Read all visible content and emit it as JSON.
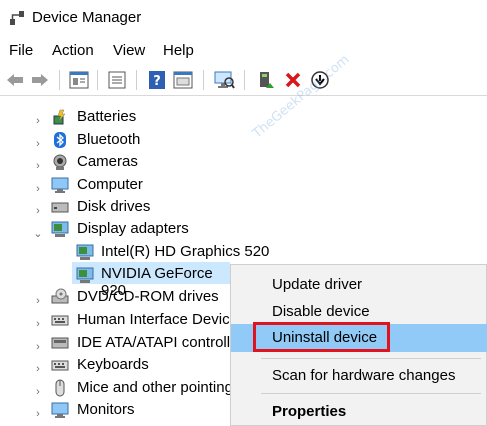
{
  "window": {
    "title": "Device Manager"
  },
  "menu": [
    "File",
    "Action",
    "View",
    "Help"
  ],
  "toolbar": {
    "buttons": [
      "back-icon",
      "forward-icon",
      "properties-icon",
      "list-icon",
      "help-icon",
      "run-icon",
      "scan-hardware-icon",
      "update-driver-icon",
      "uninstall-icon",
      "download-icon"
    ]
  },
  "tree": {
    "items": [
      {
        "label": "Batteries",
        "expanded": false
      },
      {
        "label": "Bluetooth",
        "expanded": false
      },
      {
        "label": "Cameras",
        "expanded": false
      },
      {
        "label": "Computer",
        "expanded": false
      },
      {
        "label": "Disk drives",
        "expanded": false
      },
      {
        "label": "Display adapters",
        "expanded": true
      },
      {
        "label": "Intel(R) HD Graphics 520",
        "child": true
      },
      {
        "label": "NVIDIA GeForce 920",
        "child": true,
        "selected": true
      },
      {
        "label": "DVD/CD-ROM drives",
        "expanded": false
      },
      {
        "label": "Human Interface Device",
        "expanded": false
      },
      {
        "label": "IDE ATA/ATAPI controller",
        "expanded": false
      },
      {
        "label": "Keyboards",
        "expanded": false
      },
      {
        "label": "Mice and other pointing",
        "expanded": false
      },
      {
        "label": "Monitors",
        "expanded": false
      }
    ]
  },
  "context_menu": {
    "items": [
      {
        "label": "Update driver"
      },
      {
        "label": "Disable device"
      },
      {
        "label": "Uninstall device",
        "highlighted": true
      },
      {
        "label": "Scan for hardware changes"
      },
      {
        "label": "Properties",
        "bold": true
      }
    ]
  },
  "watermark": "TheGeekPage.com",
  "colors": {
    "selection": "#cce8ff",
    "menu_hover": "#91c9f7",
    "highlight_box": "#e0141e"
  }
}
